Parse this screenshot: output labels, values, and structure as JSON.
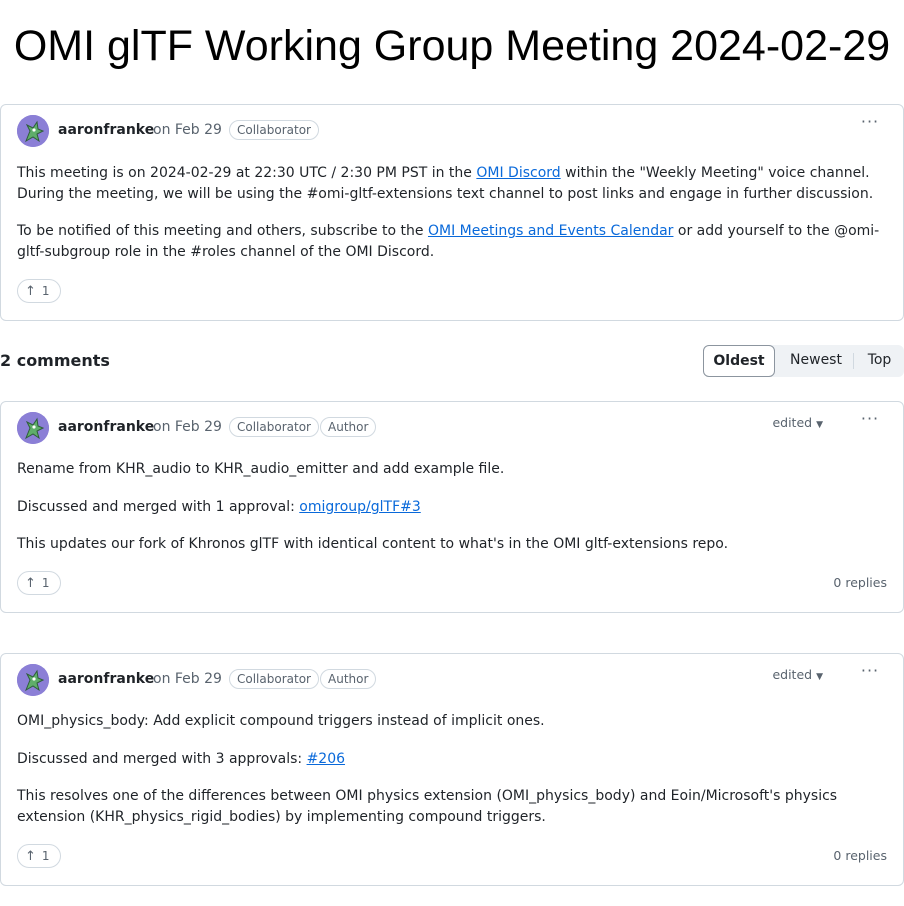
{
  "page": {
    "title": "OMI glTF Working Group Meeting 2024-02-29"
  },
  "issue": {
    "author": "aaronfranke",
    "date": "on Feb 29",
    "badges": [
      "Collaborator"
    ],
    "paragraphs": {
      "p1_before": "This meeting is on 2024-02-29 at 22:30 UTC / 2:30 PM PST in the ",
      "p1_link": "OMI Discord",
      "p1_after": " within the \"Weekly Meeting\" voice channel. During the meeting, we will be using the #omi-gltf-extensions text channel to post links and engage in further discussion.",
      "p2_before": "To be notified of this meeting and others, subscribe to the ",
      "p2_link": "OMI Meetings and Events Calendar",
      "p2_after": " or add yourself to the @omi-gltf-subgroup role in the #roles channel of the OMI Discord."
    },
    "reaction": {
      "icon": "arrow-up-icon",
      "count": "1"
    }
  },
  "comments_header": {
    "count_label": "2 comments",
    "sort_options": [
      "Oldest",
      "Newest",
      "Top"
    ],
    "selected": "Oldest"
  },
  "comments": [
    {
      "author": "aaronfranke",
      "date": "on Feb 29",
      "badges": [
        "Collaborator",
        "Author"
      ],
      "edited_label": "edited",
      "line1": "Rename from KHR_audio to KHR_audio_emitter and add example file.",
      "line2_before": "Discussed and merged with 1 approval: ",
      "line2_link": "omigroup/glTF#3",
      "line3": "This updates our fork of Khronos glTF with identical content to what's in the OMI gltf-extensions repo.",
      "reaction_count": "1",
      "replies": "0 replies"
    },
    {
      "author": "aaronfranke",
      "date": "on Feb 29",
      "badges": [
        "Collaborator",
        "Author"
      ],
      "edited_label": "edited",
      "line1": "OMI_physics_body: Add explicit compound triggers instead of implicit ones.",
      "line2_before": "Discussed and merged with 3 approvals: ",
      "line2_link": "#206",
      "line3": "This resolves one of the differences between OMI physics extension (OMI_physics_body) and Eoin/Microsoft's physics extension (KHR_physics_rigid_bodies) by implementing compound triggers.",
      "reaction_count": "1",
      "replies": "0 replies"
    }
  ],
  "colors": {
    "link": "#0969da",
    "border": "#d1d9e0",
    "muted": "#59636e",
    "avatar": "#8b7fd6"
  }
}
